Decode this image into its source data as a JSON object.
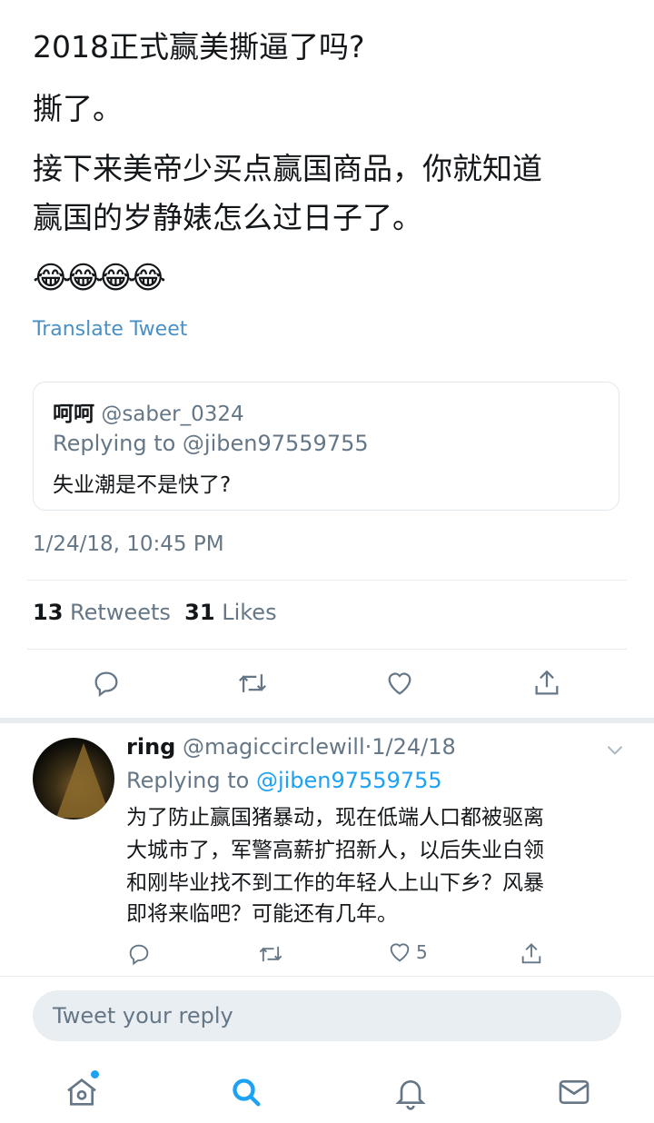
{
  "tweet": {
    "lines": [
      "2018正式赢美撕逼了吗?",
      "撕了。",
      "接下来美帝少买点赢国商品，你就知道",
      "赢国的岁静婊怎么过日子了。"
    ],
    "emoji": "😂😂😂😂",
    "translate_label": "Translate Tweet",
    "timestamp": "1/24/18, 10:45 PM",
    "retweets_count": "13",
    "retweets_label": "Retweets",
    "likes_count": "31",
    "likes_label": "Likes"
  },
  "quote": {
    "name": "呵呵",
    "handle": "@saber_0324",
    "replying": "Replying to @jiben97559755",
    "text": "失业潮是不是快了?"
  },
  "reply": {
    "name": "ring",
    "handle": "@magiccirclewill",
    "separator": "·",
    "date": "1/24/18",
    "replying_prefix": "Replying to",
    "replying_handle": "@jiben97559755",
    "lines": [
      "为了防止赢国猪暴动，现在低端人口都被驱离",
      "大城市了，军警高薪扩招新人，以后失业白领",
      "和刚毕业找不到工作的年轻人上山下乡？风暴",
      "即将来临吧？可能还有几年。"
    ],
    "likes_count": "5"
  },
  "composer": {
    "placeholder": "Tweet your reply"
  },
  "icons": {
    "reply": "reply-icon",
    "retweet": "retweet-icon",
    "like": "heart-icon",
    "share": "share-icon",
    "home": "home-icon",
    "search": "search-icon",
    "notifications": "bell-icon",
    "messages": "mail-icon"
  },
  "colors": {
    "accent": "#1da1f2",
    "gray_text": "#657786",
    "translate": "#4a90c4"
  }
}
